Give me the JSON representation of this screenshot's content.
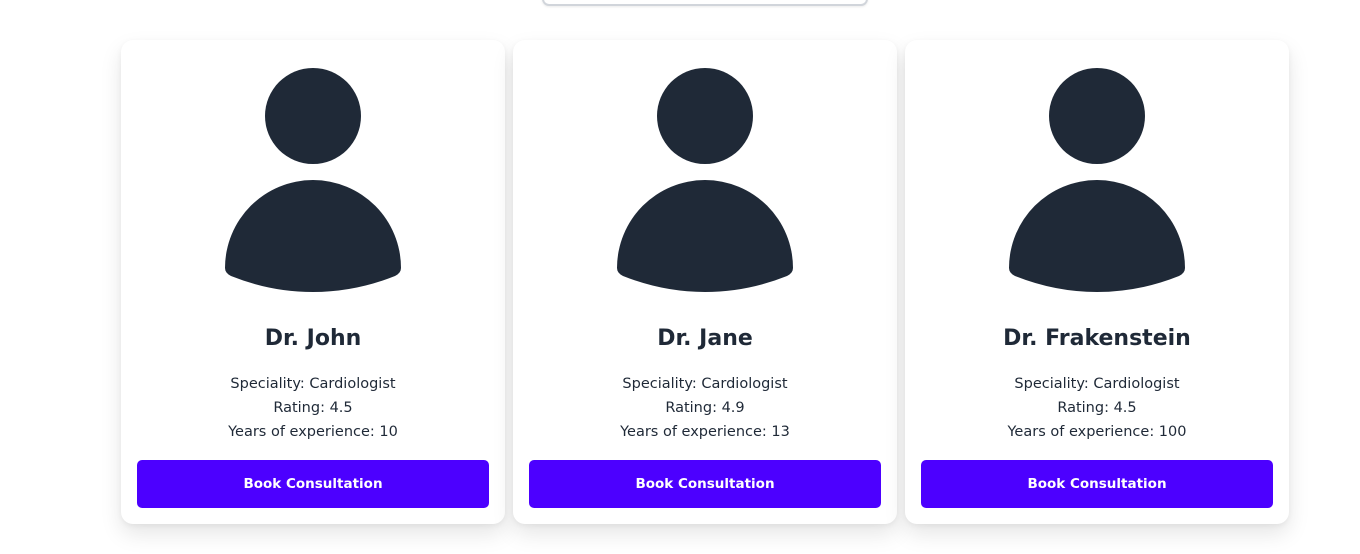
{
  "search": {
    "placeholder": ""
  },
  "doctors": [
    {
      "name": "Dr. John",
      "speciality": "Speciality: Cardiologist",
      "rating": "Rating: 4.5",
      "experience": "Years of experience: 10",
      "button_label": "Book Consultation"
    },
    {
      "name": "Dr. Jane",
      "speciality": "Speciality: Cardiologist",
      "rating": "Rating: 4.9",
      "experience": "Years of experience: 13",
      "button_label": "Book Consultation"
    },
    {
      "name": "Dr. Frakenstein",
      "speciality": "Speciality: Cardiologist",
      "rating": "Rating: 4.5",
      "experience": "Years of experience: 100",
      "button_label": "Book Consultation"
    }
  ],
  "colors": {
    "accent": "#4c00ff",
    "avatar": "#1f2937",
    "text": "#1f2937"
  },
  "icons": {
    "avatar": "user-avatar-icon"
  }
}
